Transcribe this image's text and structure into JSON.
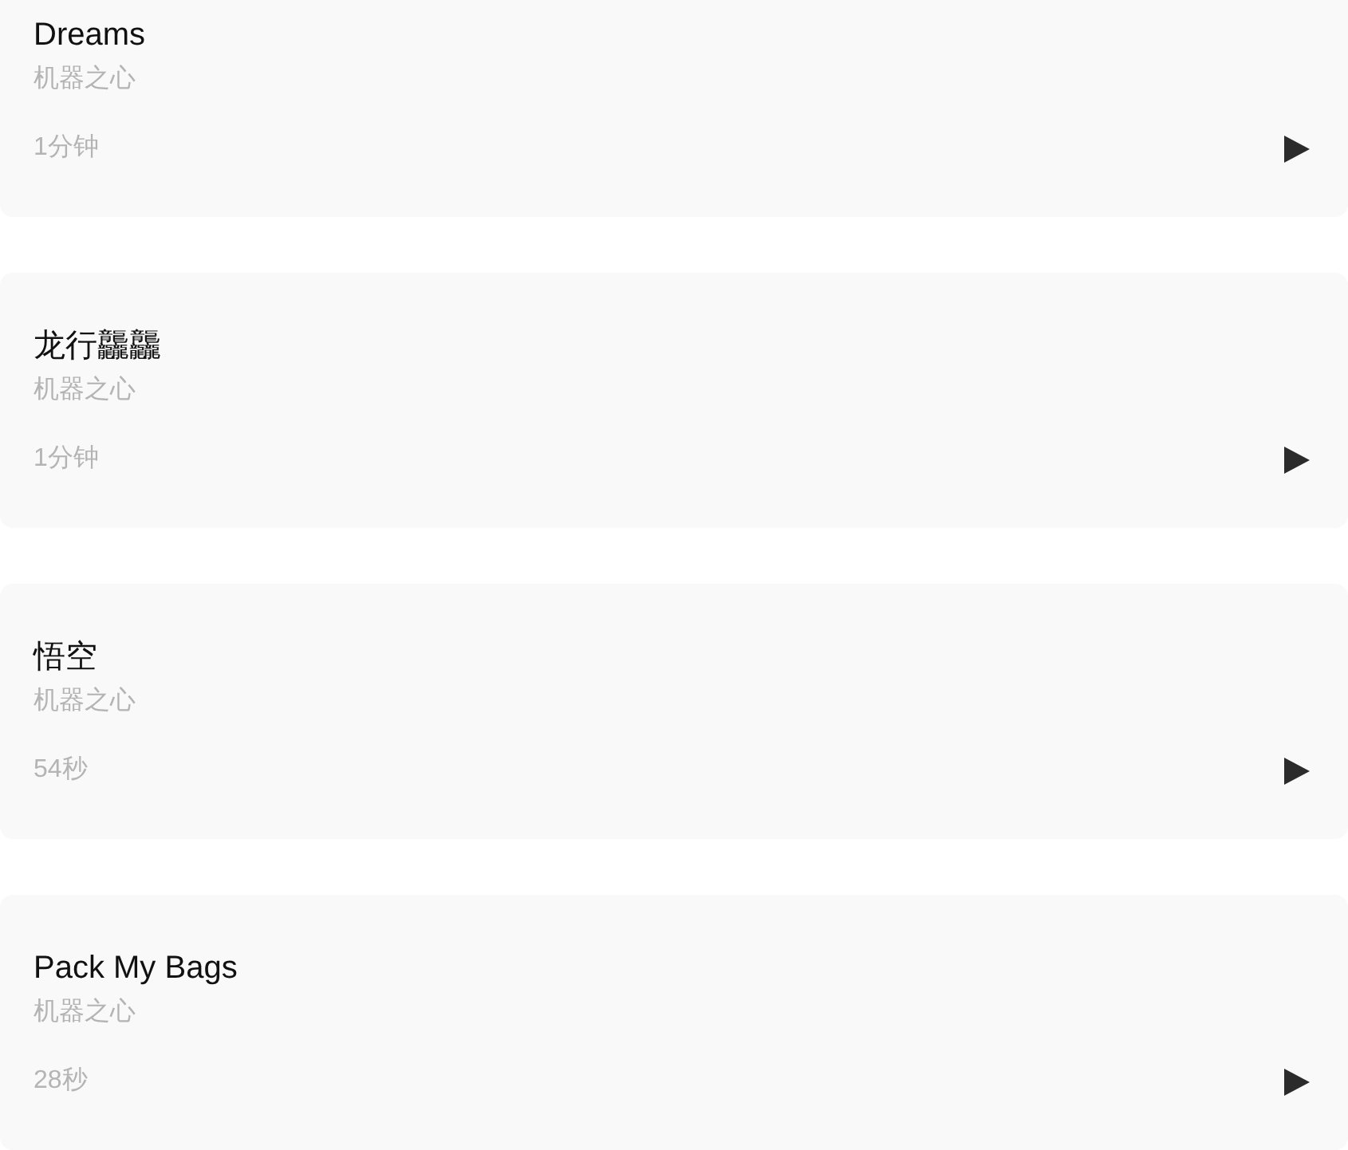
{
  "tracks": [
    {
      "title": "Dreams",
      "author": "机器之心",
      "duration": "1分钟"
    },
    {
      "title": "龙行龘龘",
      "author": "机器之心",
      "duration": "1分钟"
    },
    {
      "title": "悟空",
      "author": "机器之心",
      "duration": "54秒"
    },
    {
      "title": "Pack My Bags",
      "author": "机器之心",
      "duration": "28秒"
    }
  ]
}
